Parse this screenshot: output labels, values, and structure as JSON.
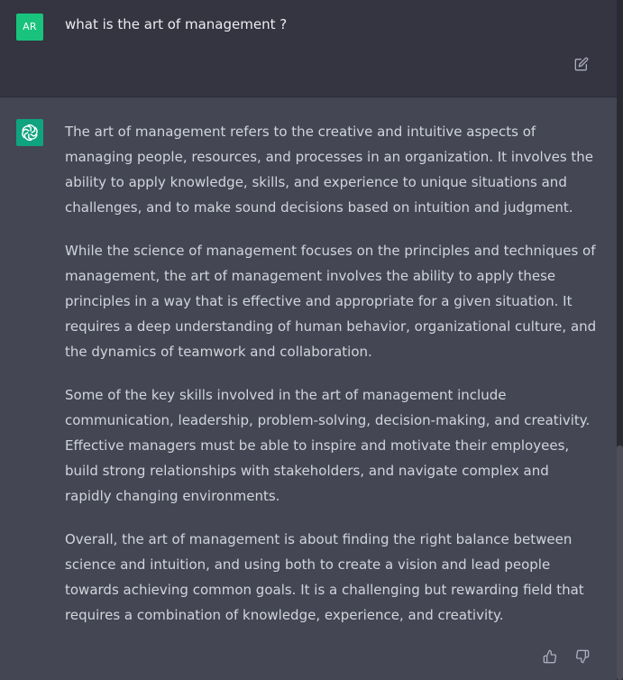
{
  "user_message": {
    "avatar_initials": "AR",
    "text": "what is the art of management ?",
    "edit_icon": "edit-icon"
  },
  "assistant_message": {
    "avatar_icon": "openai-logo-icon",
    "paragraphs": [
      "The art of management refers to the creative and intuitive aspects of managing people, resources, and processes in an organization. It involves the ability to apply knowledge, skills, and experience to unique situations and challenges, and to make sound decisions based on intuition and judgment.",
      "While the science of management focuses on the principles and techniques of management, the art of management involves the ability to apply these principles in a way that is effective and appropriate for a given situation. It requires a deep understanding of human behavior, organizational culture, and the dynamics of teamwork and collaboration.",
      "Some of the key skills involved in the art of management include communication, leadership, problem-solving, decision-making, and creativity. Effective managers must be able to inspire and motivate their employees, build strong relationships with stakeholders, and navigate complex and rapidly changing environments.",
      "Overall, the art of management is about finding the right balance between science and intuition, and using both to create a vision and lead people towards achieving common goals. It is a challenging but rewarding field that requires a combination of knowledge, experience, and creativity."
    ],
    "feedback_icons": [
      "thumbs-up-icon",
      "thumbs-down-icon"
    ]
  },
  "colors": {
    "user_background": "#343541",
    "assistant_background": "#444654",
    "user_avatar": "#19c37d",
    "assistant_avatar": "#10a37f",
    "text_primary": "#ececf1",
    "text_secondary": "#d1d5db"
  }
}
